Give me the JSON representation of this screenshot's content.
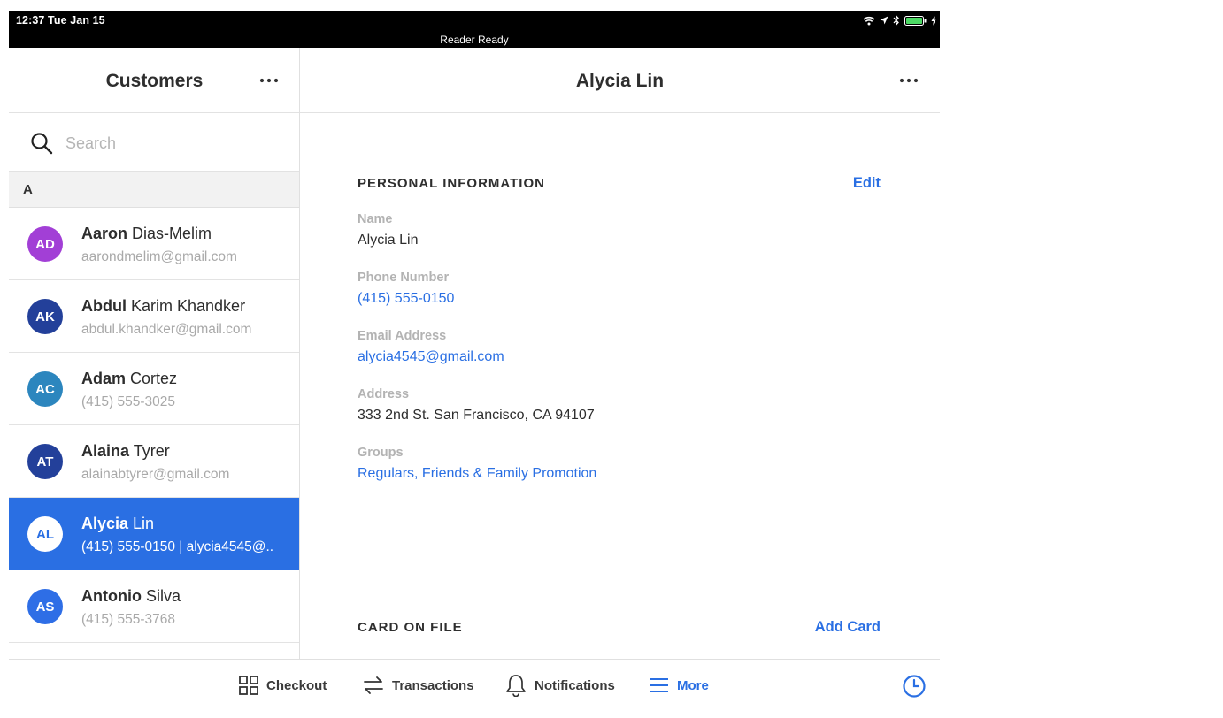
{
  "status_bar": {
    "time": "12:37 Tue Jan 15",
    "center_text": "Reader Ready"
  },
  "left_pane": {
    "title": "Customers",
    "search_placeholder": "Search",
    "section_letter": "A",
    "customers": [
      {
        "initials": "AD",
        "first": "Aaron",
        "last": " Dias-Melim",
        "sub": "aarondmelim@gmail.com",
        "color": "#a23fd6",
        "selected": false
      },
      {
        "initials": "AK",
        "first": "Abdul",
        "last": " Karim Khandker",
        "sub": "abdul.khandker@gmail.com",
        "color": "#23409a",
        "selected": false
      },
      {
        "initials": "AC",
        "first": "Adam",
        "last": " Cortez",
        "sub": "(415) 555-3025",
        "color": "#2c86be",
        "selected": false
      },
      {
        "initials": "AT",
        "first": "Alaina",
        "last": " Tyrer",
        "sub": "alainabtyrer@gmail.com",
        "color": "#23409a",
        "selected": false
      },
      {
        "initials": "AL",
        "first": "Alycia",
        "last": " Lin",
        "sub": "(415) 555-0150 | alycia4545@..",
        "color": "#ffffff",
        "selected": true
      },
      {
        "initials": "AS",
        "first": "Antonio",
        "last": " Silva",
        "sub": "(415) 555-3768",
        "color": "#2e6ee6",
        "selected": false
      }
    ]
  },
  "detail": {
    "title": "Alycia Lin",
    "personal_heading": "PERSONAL INFORMATION",
    "edit_label": "Edit",
    "fields": {
      "name_label": "Name",
      "name_value": "Alycia Lin",
      "phone_label": "Phone Number",
      "phone_value": "(415) 555-0150",
      "email_label": "Email Address",
      "email_value": "alycia4545@gmail.com",
      "address_label": "Address",
      "address_value": "333 2nd St. San Francisco, CA 94107",
      "groups_label": "Groups",
      "groups_value": "Regulars, Friends & Family Promotion"
    },
    "card_heading": "CARD ON FILE",
    "add_card_label": "Add Card"
  },
  "tab_bar": {
    "tabs": [
      {
        "label": "Checkout",
        "icon": "grid-icon",
        "active": false
      },
      {
        "label": "Transactions",
        "icon": "swap-arrows-icon",
        "active": false
      },
      {
        "label": "Notifications",
        "icon": "bell-icon",
        "active": false
      },
      {
        "label": "More",
        "icon": "hamburger-icon",
        "active": true
      }
    ],
    "clock_icon": "clock-icon"
  },
  "colors": {
    "accent": "#2a6fe3",
    "selected_row": "#2a6fe3",
    "label_gray": "#b3b3b3",
    "section_bg": "#f2f2f2"
  }
}
